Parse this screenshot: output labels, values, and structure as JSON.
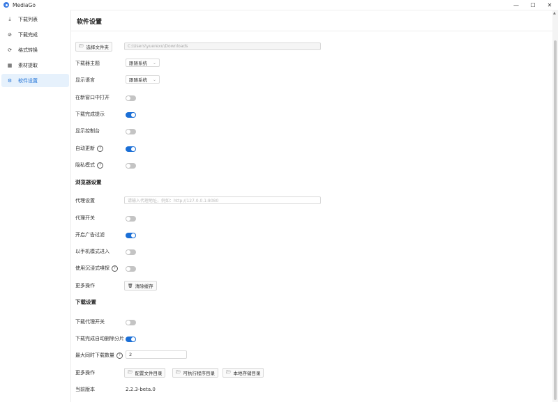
{
  "window": {
    "title": "MediaGo"
  },
  "window_controls": {
    "minimize": "—",
    "maximize": "☐",
    "close": "✕"
  },
  "sidebar": {
    "items": [
      {
        "label": "下载列表",
        "icon": "download-icon",
        "glyph": "⤓"
      },
      {
        "label": "下载完成",
        "icon": "check-circle-icon",
        "glyph": "⊘"
      },
      {
        "label": "格式转换",
        "icon": "convert-icon",
        "glyph": "⟳"
      },
      {
        "label": "素材提取",
        "icon": "grid-icon",
        "glyph": "▦"
      },
      {
        "label": "软件设置",
        "icon": "gear-icon",
        "glyph": "⚙"
      }
    ],
    "active_index": 4
  },
  "page": {
    "title": "软件设置"
  },
  "settings": {
    "choose_folder_label": "选择文件夹",
    "download_path": "C:\\Users\\yuerexu\\Downloads",
    "theme_label": "下载器主题",
    "theme_value": "跟随系统",
    "language_label": "显示语言",
    "language_value": "跟随系统",
    "open_in_new_window_label": "在新窗口中打开",
    "open_in_new_window": false,
    "download_done_tip_label": "下载完成提示",
    "download_done_tip": true,
    "show_console_label": "显示控制台",
    "show_console": false,
    "auto_update_label": "自动更新",
    "auto_update": true,
    "privacy_mode_label": "隐私模式",
    "privacy_mode": false
  },
  "browser": {
    "section_title": "浏览器设置",
    "proxy_label": "代理设置",
    "proxy_placeholder": "请输入代理地址，例如：http://127.0.0.1:8080",
    "proxy_switch_label": "代理开关",
    "proxy_switch": false,
    "adblock_label": "开启广告过滤",
    "adblock": true,
    "mobile_mode_label": "以手机模式进入",
    "mobile_mode": false,
    "immersive_sniff_label": "使用沉浸式嗅探",
    "immersive_sniff": false,
    "more_label": "更多操作",
    "clear_cache_label": "清除缓存"
  },
  "download": {
    "section_title": "下载设置",
    "proxy_switch_label": "下载代理开关",
    "proxy_switch": false,
    "delete_segments_label": "下载完成自动删除分片",
    "delete_segments": true,
    "max_concurrent_label": "最大同时下载数量",
    "max_concurrent_value": "2",
    "more_label": "更多操作",
    "config_dir_label": "配置文件目录",
    "exe_dir_label": "可执行程序目录",
    "storage_dir_label": "本地存储目录",
    "version_label": "当前版本",
    "version_value": "2.2.3-beta.0"
  }
}
